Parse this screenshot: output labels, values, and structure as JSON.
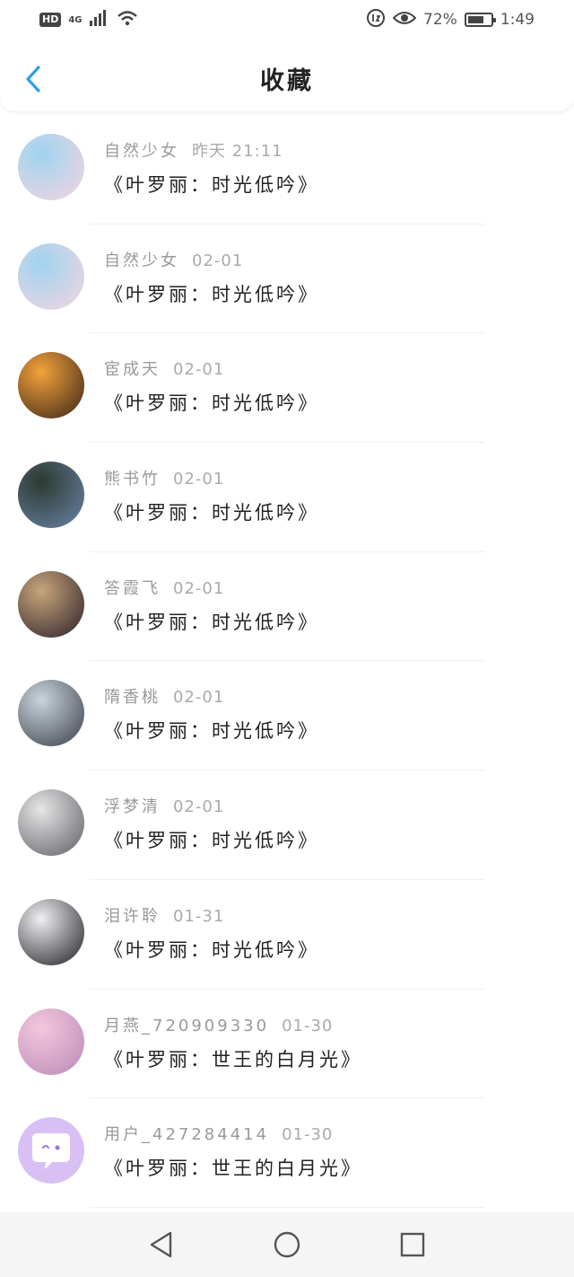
{
  "status_bar": {
    "network_badge": "HD",
    "signal_label": "4G",
    "battery_text": "72%",
    "battery_level": 0.72,
    "time": "1:49"
  },
  "header": {
    "title": "收藏"
  },
  "favorites": [
    {
      "user": "自然少女",
      "date": "昨天 21:11",
      "post": "《叶罗丽：时光低吟》",
      "avatar_colors": [
        "#9fd3f0",
        "#f5d5e0"
      ]
    },
    {
      "user": "自然少女",
      "date": "02-01",
      "post": "《叶罗丽：时光低吟》",
      "avatar_colors": [
        "#9fd3f0",
        "#f5d5e0"
      ]
    },
    {
      "user": "宦成天",
      "date": "02-01",
      "post": "《叶罗丽：时光低吟》",
      "avatar_colors": [
        "#f2a23a",
        "#3a2418"
      ]
    },
    {
      "user": "熊书竹",
      "date": "02-01",
      "post": "《叶罗丽：时光低吟》",
      "avatar_colors": [
        "#2b3a30",
        "#6a84a8"
      ]
    },
    {
      "user": "答霞飞",
      "date": "02-01",
      "post": "《叶罗丽：时光低吟》",
      "avatar_colors": [
        "#c8a67a",
        "#2c1f2a"
      ]
    },
    {
      "user": "隋香桃",
      "date": "02-01",
      "post": "《叶罗丽：时光低吟》",
      "avatar_colors": [
        "#c9d4dc",
        "#3b3f4a"
      ]
    },
    {
      "user": "浮梦清",
      "date": "02-01",
      "post": "《叶罗丽：时光低吟》",
      "avatar_colors": [
        "#e6e6e6",
        "#5e5e66"
      ]
    },
    {
      "user": "泪许聆",
      "date": "01-31",
      "post": "《叶罗丽：时光低吟》",
      "avatar_colors": [
        "#f0f0f2",
        "#1e1e24"
      ]
    },
    {
      "user": "月燕_720909330",
      "date": "01-30",
      "post": "《叶罗丽：世王的白月光》",
      "avatar_colors": [
        "#f3c7dc",
        "#b98ab8"
      ]
    },
    {
      "user": "用户_427284414",
      "date": "01-30",
      "post": "《叶罗丽：世王的白月光》",
      "avatar_colors": [
        "#d8c0f5",
        "#c3a4ef"
      ]
    }
  ]
}
